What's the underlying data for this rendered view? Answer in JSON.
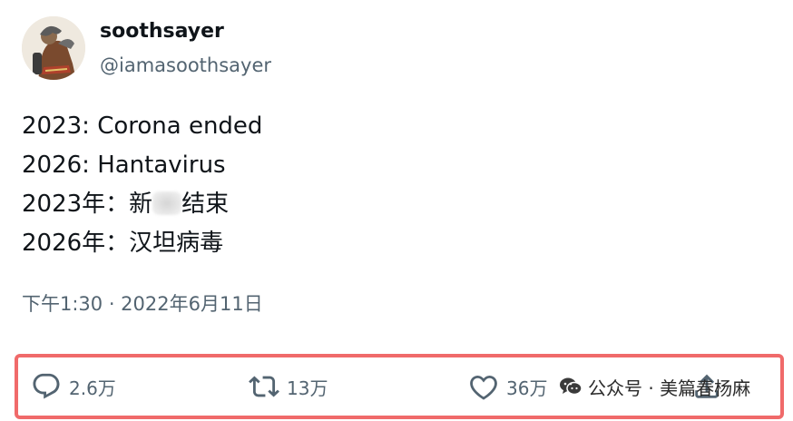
{
  "user": {
    "display_name": "soothsayer",
    "handle": "@iamasoothsayer"
  },
  "tweet": {
    "lines": [
      "2023: Corona ended",
      "2026: Hantavirus",
      "2023年：新",
      "结束",
      "2026年：汉坦病毒"
    ],
    "timestamp": "下午1:30 · 2022年6月11日"
  },
  "actions": {
    "reply_count": "2.6万",
    "retweet_count": "13万",
    "like_count": "36万"
  },
  "watermark": {
    "text": "公众号 · 美篇春杨麻"
  },
  "colors": {
    "text": "#0f1419",
    "secondary": "#536471",
    "highlight_border": "#f06a6a"
  },
  "icons": [
    "reply-icon",
    "retweet-icon",
    "like-icon",
    "share-icon",
    "wechat-icon"
  ]
}
